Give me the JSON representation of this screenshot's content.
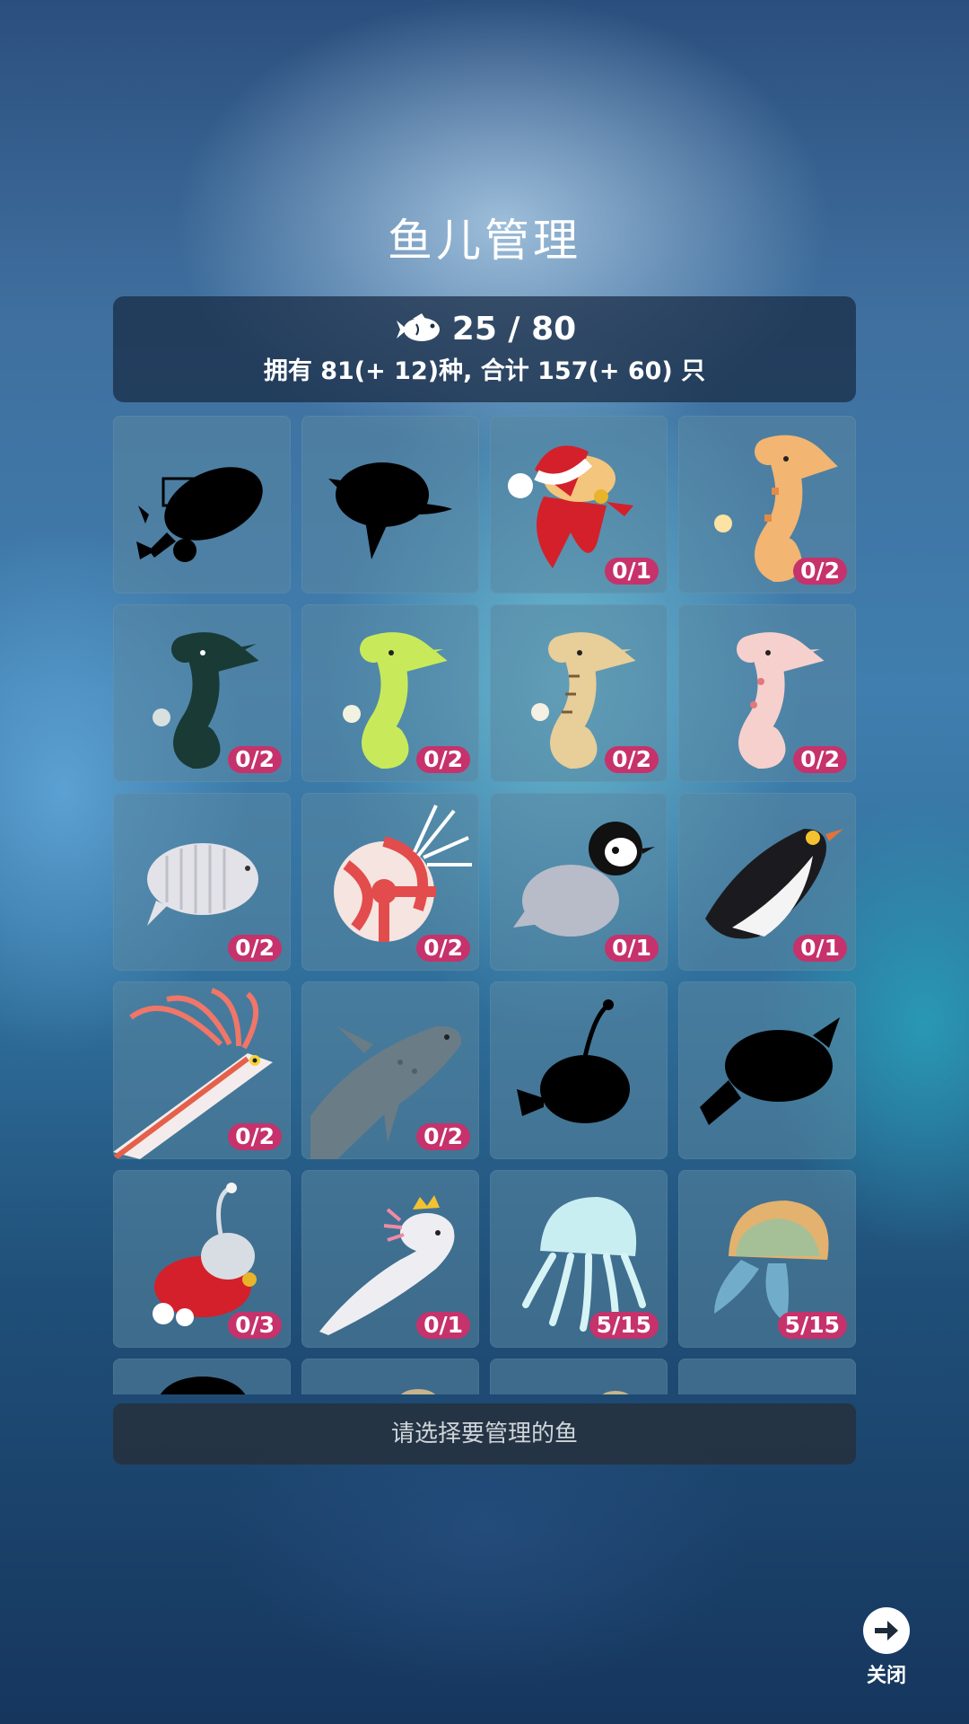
{
  "title": "鱼儿管理",
  "stats": {
    "icon": "fish-icon",
    "count": "25 / 80",
    "summary": "拥有 81(+ 12)种, 合计 157(+ 60) 只"
  },
  "fish": [
    {
      "name": "silhouette-fish-1",
      "badge": ""
    },
    {
      "name": "silhouette-fish-2",
      "badge": ""
    },
    {
      "name": "santa-fish",
      "badge": "0/1"
    },
    {
      "name": "orange-seahorse",
      "badge": "0/2"
    },
    {
      "name": "dark-seahorse",
      "badge": "0/2"
    },
    {
      "name": "lime-seahorse",
      "badge": "0/2"
    },
    {
      "name": "tan-seahorse",
      "badge": "0/2"
    },
    {
      "name": "pink-seahorse",
      "badge": "0/2"
    },
    {
      "name": "isopod",
      "badge": "0/2"
    },
    {
      "name": "nautilus",
      "badge": "0/2"
    },
    {
      "name": "baby-penguin",
      "badge": "0/1"
    },
    {
      "name": "emperor-penguin",
      "badge": "0/1"
    },
    {
      "name": "oarfish",
      "badge": "0/2"
    },
    {
      "name": "coelacanth",
      "badge": "0/2"
    },
    {
      "name": "silhouette-anglerfish",
      "badge": ""
    },
    {
      "name": "silhouette-fish-3",
      "badge": ""
    },
    {
      "name": "santa-anglerfish",
      "badge": "0/3"
    },
    {
      "name": "axolotl-crown",
      "badge": "0/1"
    },
    {
      "name": "moon-jellyfish",
      "badge": "5/15"
    },
    {
      "name": "rainbow-jellyfish",
      "badge": "5/15"
    },
    {
      "name": "partial-1",
      "badge": ""
    },
    {
      "name": "partial-2",
      "badge": ""
    },
    {
      "name": "partial-3",
      "badge": ""
    },
    {
      "name": "partial-4",
      "badge": ""
    }
  ],
  "bottom_hint": "请选择要管理的鱼",
  "close": {
    "icon": "arrow-right-icon",
    "label": "关闭"
  },
  "colors": {
    "badge": "#c6326b",
    "panel": "#182a42"
  }
}
